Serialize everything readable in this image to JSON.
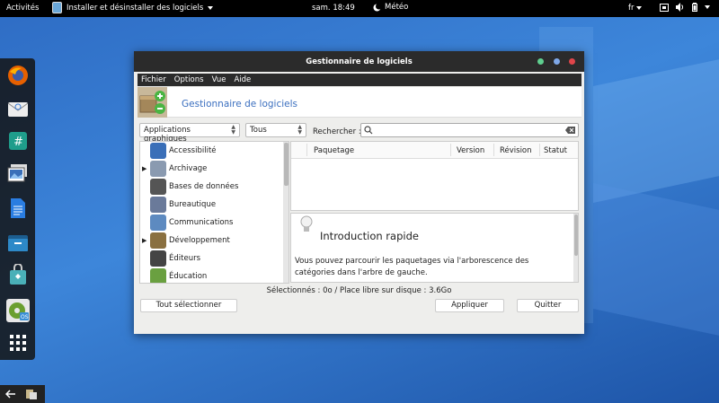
{
  "topbar": {
    "activities": "Activités",
    "app_menu_label": "Installer et désinstaller des logiciels",
    "clock": "sam. 18:49",
    "weather": "Météo",
    "language": "fr"
  },
  "window": {
    "title": "Gestionnaire de logiciels",
    "menu": [
      "Fichier",
      "Options",
      "Vue",
      "Aide"
    ],
    "banner_title": "Gestionnaire de logiciels",
    "filters": {
      "category_filter": "Applications graphiques",
      "status_filter": "Tous",
      "search_label": "Rechercher :",
      "search_value": ""
    },
    "categories": [
      {
        "label": "Accessibilité",
        "expandable": false,
        "icon": "accessibility-icon"
      },
      {
        "label": "Archivage",
        "expandable": true,
        "icon": "archive-icon"
      },
      {
        "label": "Bases de données",
        "expandable": false,
        "icon": "database-icon"
      },
      {
        "label": "Bureautique",
        "expandable": false,
        "icon": "office-icon"
      },
      {
        "label": "Communications",
        "expandable": false,
        "icon": "communications-icon"
      },
      {
        "label": "Développement",
        "expandable": true,
        "icon": "development-icon"
      },
      {
        "label": "Éditeurs",
        "expandable": false,
        "icon": "editors-icon"
      },
      {
        "label": "Éducation",
        "expandable": false,
        "icon": "education-icon"
      }
    ],
    "package_columns": [
      "Paquetage",
      "Version",
      "Révision",
      "Statut"
    ],
    "intro": {
      "title": "Introduction rapide",
      "text": "Vous pouvez parcourir les paquetages via l'arborescence des catégories dans l'arbre de gauche."
    },
    "status_line": "Sélectionnés : 0o / Place libre sur disque : 3.6Go",
    "buttons": {
      "select_all": "Tout sélectionner",
      "apply": "Appliquer",
      "quit": "Quitter"
    }
  },
  "colors": {
    "desktop_blue": "#2e6cc4",
    "banner_title": "#3b6fbf",
    "btn_green": "#5fcf8f",
    "btn_blue": "#7fa8e8",
    "btn_red": "#e0454a"
  }
}
